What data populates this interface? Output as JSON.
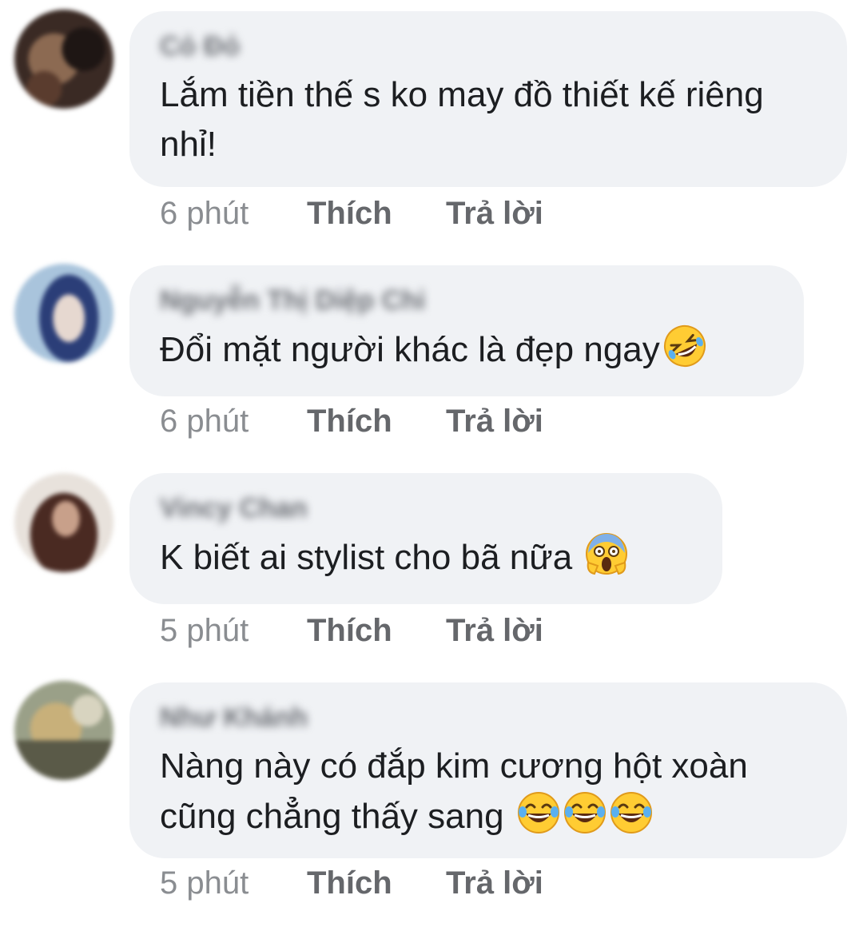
{
  "comments": [
    {
      "author": "Cỏ Đỏ",
      "text": "Lắm tiền thế s ko may đồ thiết kế riêng nhỉ!",
      "emoji": "",
      "time": "6 phút",
      "like_label": "Thích",
      "reply_label": "Trả lời",
      "avatar_colors": [
        "#3a2a24",
        "#8c6a52",
        "#1e1614"
      ]
    },
    {
      "author": "Nguyễn Thị Diệp Chi",
      "text": "Đổi mặt người khác là đẹp ngay",
      "emoji": "rolling-on-floor-laughing-emoji",
      "time": "6 phút",
      "like_label": "Thích",
      "reply_label": "Trả lời",
      "avatar_colors": [
        "#a9c4dc",
        "#2b3e78",
        "#e6d8d0"
      ]
    },
    {
      "author": "Vincy Chan",
      "text": "K biết ai stylist cho bã nữa",
      "emoji": "screaming-in-fear-emoji",
      "time": "5 phút",
      "like_label": "Thích",
      "reply_label": "Trả lời",
      "avatar_colors": [
        "#e8e2dc",
        "#4a2a22",
        "#c8a08a"
      ]
    },
    {
      "author": "Như Khánh",
      "text": "Nàng này có đắp kim cương hột xoàn cũng chẳng thấy sang",
      "emoji": "tears-of-joy-emoji x3",
      "time": "5 phút",
      "like_label": "Thích",
      "reply_label": "Trả lời",
      "avatar_colors": [
        "#9aa088",
        "#c8b07a",
        "#5a5a48"
      ]
    }
  ],
  "colors": {
    "bubble": "#f0f2f5",
    "text": "#1c1e21",
    "meta": "#8a8d91",
    "action": "#65676b",
    "emoji_face": "#ffcc33"
  }
}
